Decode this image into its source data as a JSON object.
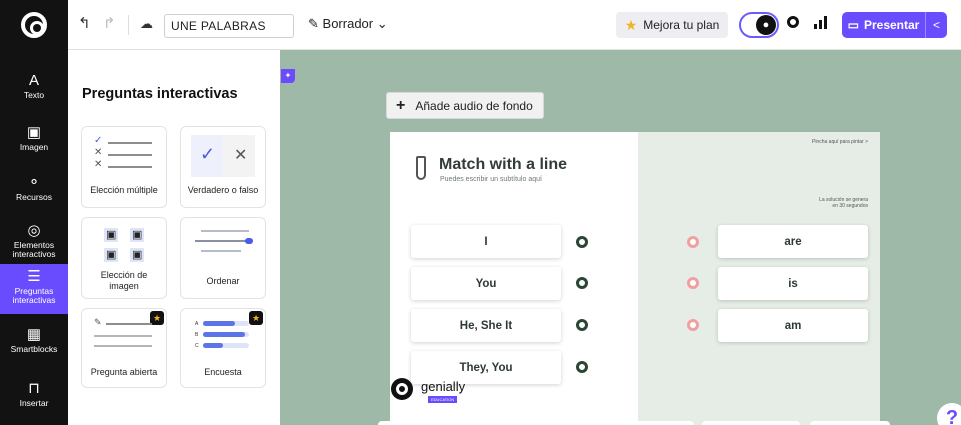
{
  "header": {
    "project_title": "UNE PALABRAS",
    "status_label": "Borrador",
    "plan_button": "Mejora tu plan",
    "present_button": "Presentar",
    "icons": [
      "genially-logo-icon",
      "undo-icon",
      "redo-icon",
      "cloud-icon",
      "pencil-icon",
      "chevron-down-icon",
      "star-icon",
      "avatar-icon",
      "eye-icon",
      "stats-icon",
      "present-icon",
      "share-icon"
    ]
  },
  "rail": {
    "items": [
      {
        "label": "Texto",
        "icon": "A",
        "active": false
      },
      {
        "label": "Imagen",
        "icon": "▣",
        "active": false
      },
      {
        "label": "Recursos",
        "icon": "⚬",
        "active": false
      },
      {
        "label": "Elementos interactivos",
        "icon": "◎",
        "active": false
      },
      {
        "label": "Preguntas interactivas",
        "icon": "☰",
        "active": true
      },
      {
        "label": "Smartblocks",
        "icon": "▦",
        "active": false
      },
      {
        "label": "Insertar",
        "icon": "⊓",
        "active": false
      }
    ]
  },
  "panel": {
    "title": "Preguntas interactivas",
    "cards": [
      {
        "label": "Elección múltiple",
        "premium": false
      },
      {
        "label": "Verdadero o falso",
        "premium": false
      },
      {
        "label": "Elección de imagen",
        "premium": false
      },
      {
        "label": "Ordenar",
        "premium": false
      },
      {
        "label": "Pregunta abierta",
        "premium": true
      },
      {
        "label": "Encuesta",
        "premium": true
      }
    ]
  },
  "canvas": {
    "audio_button": "Añade audio de fondo",
    "slide": {
      "title": "Match with a line",
      "subtitle": "Puedes escribir un subtítulo aquí",
      "note_top": "Pincha aquí para pintar >",
      "note_solution": "La solución se genera\nen 30 segundos",
      "left_items": [
        "I",
        "You",
        "He, She It",
        "They, You"
      ],
      "right_items": [
        "are",
        "is",
        "am"
      ],
      "brand": "genially",
      "brand_tag": "EDUCATION"
    }
  },
  "colors": {
    "accent": "#6a4cff",
    "canvas_bg": "#9fb9a9",
    "dark_rail": "#121212",
    "dot_green": "#2b4634",
    "dot_pink": "#f0a0a0"
  }
}
